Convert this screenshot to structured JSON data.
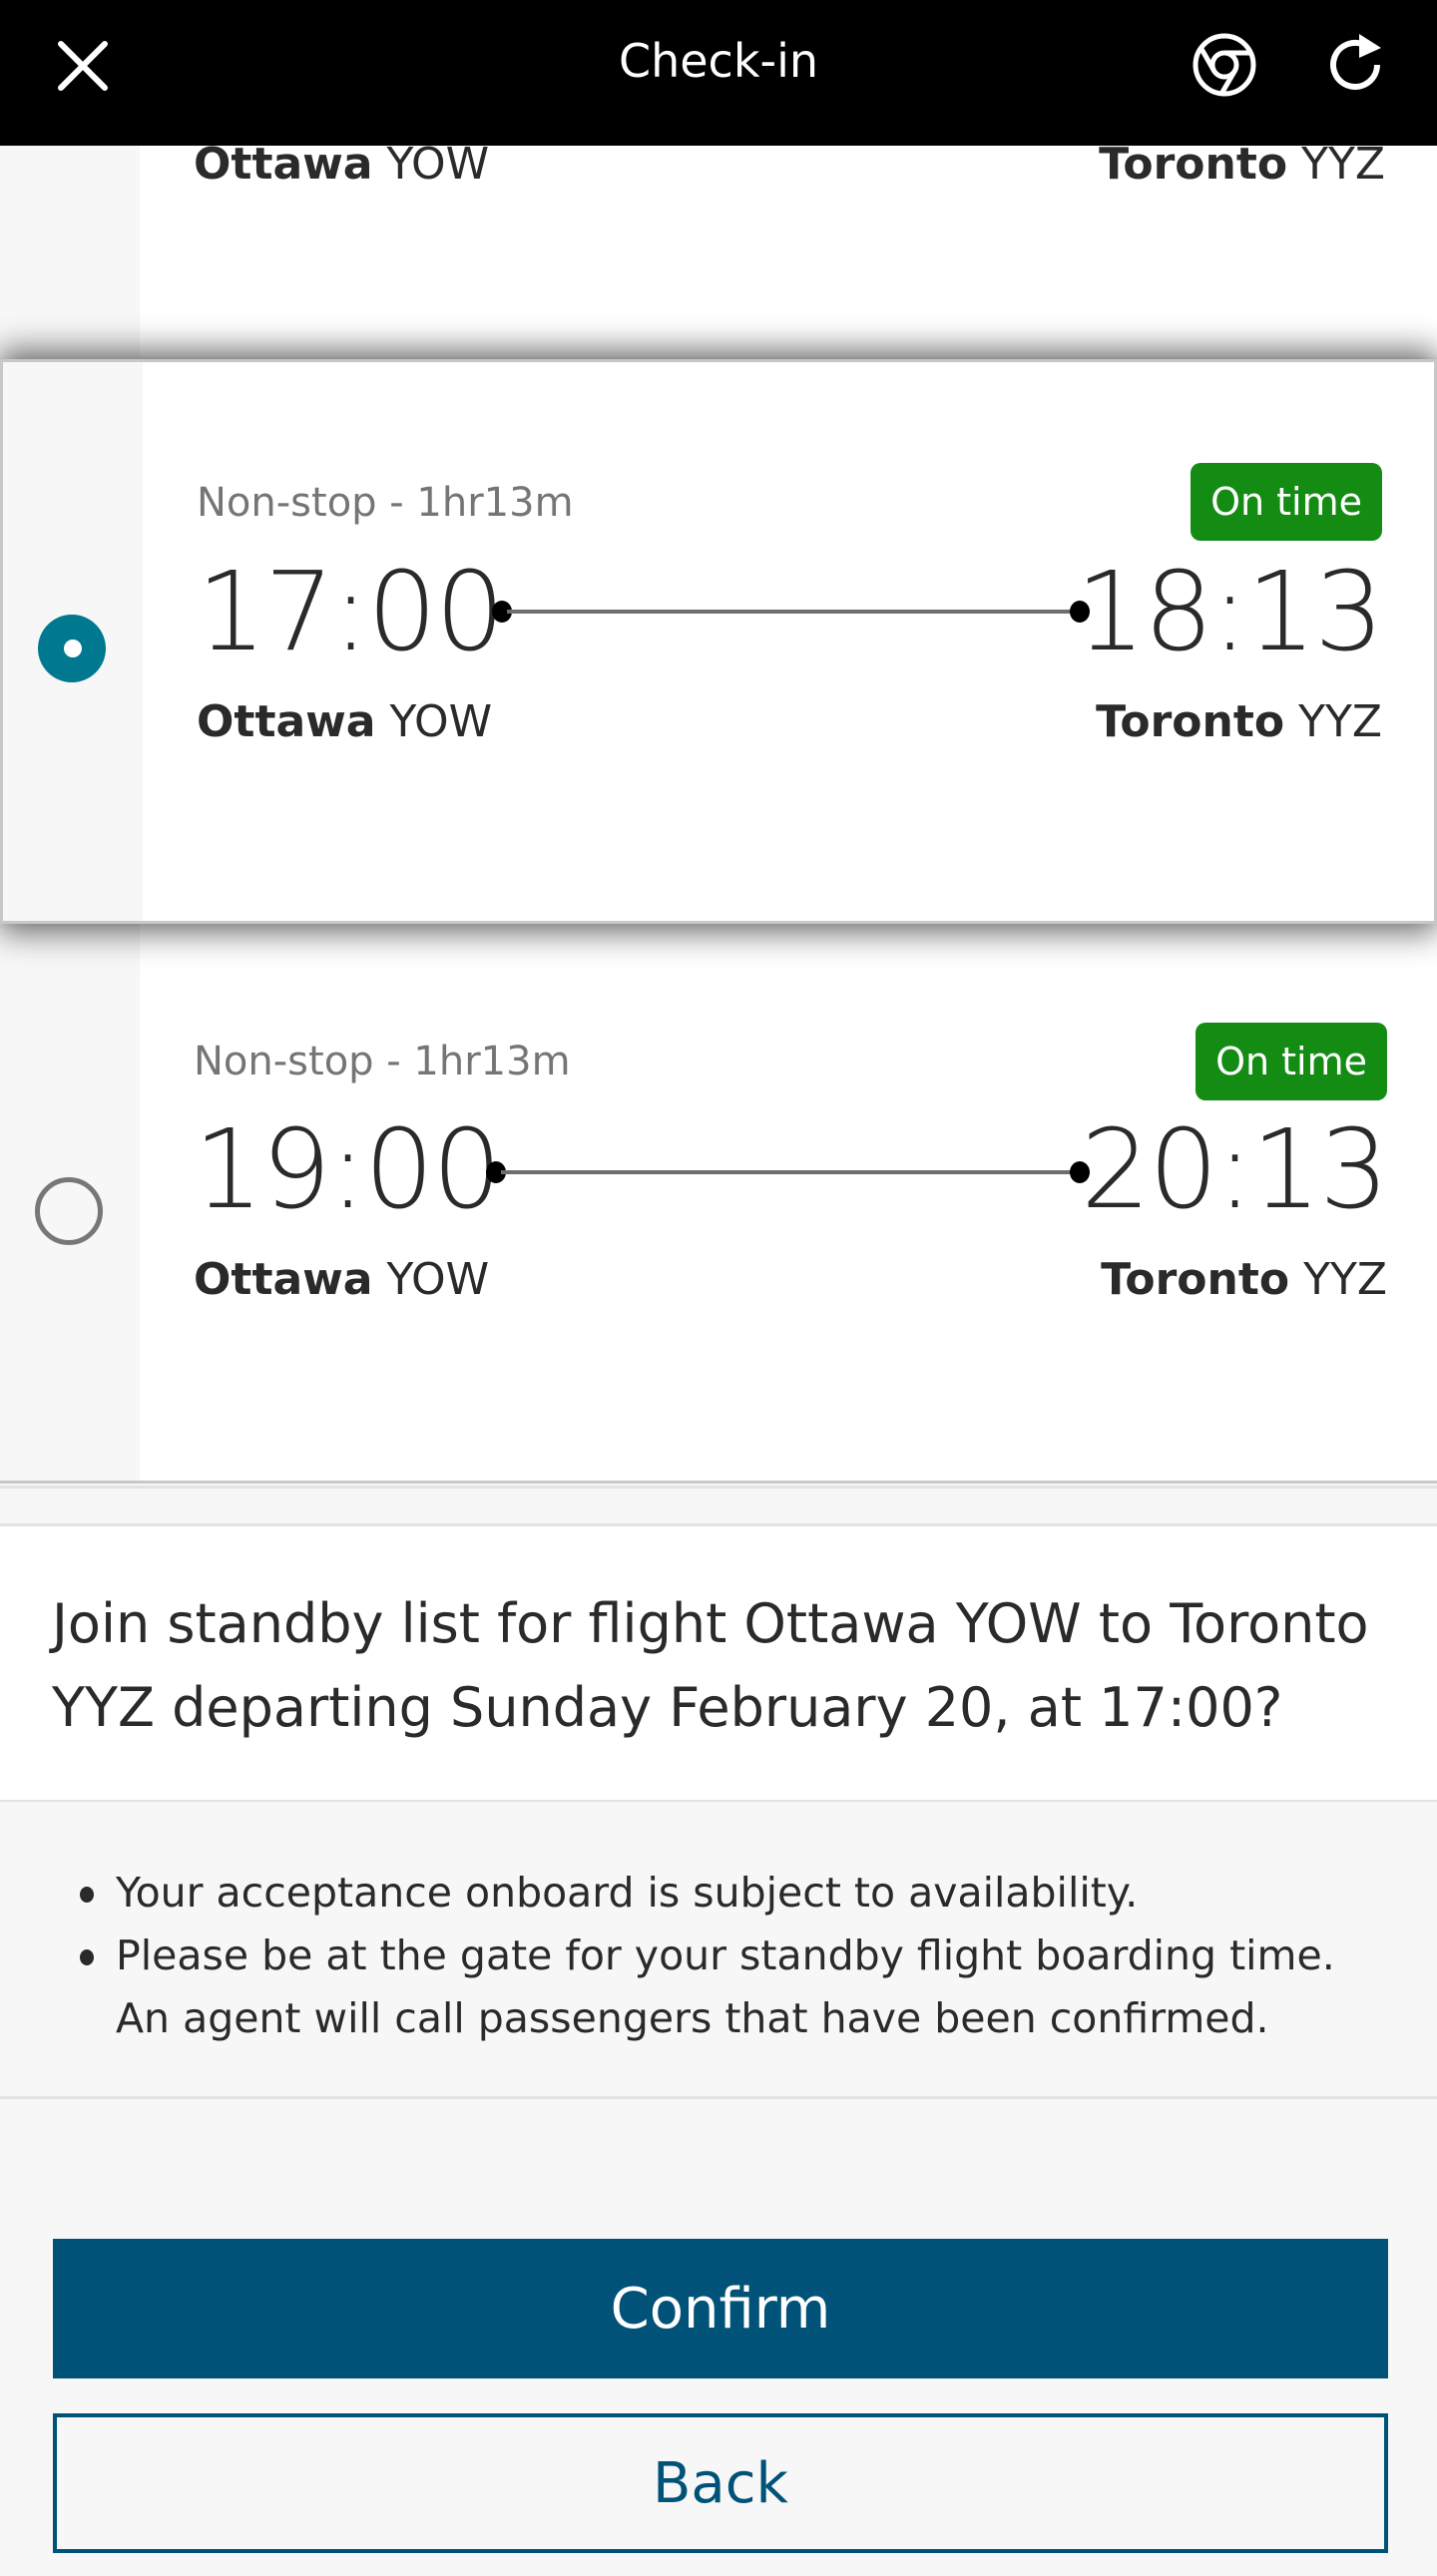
{
  "header": {
    "title": "Check-in",
    "close_icon": "close-icon",
    "browser_icon": "chrome-icon",
    "reload_icon": "reload-icon"
  },
  "flights": [
    {
      "selected": false,
      "partially_visible": true,
      "origin_city": "Ottawa",
      "origin_code": "YOW",
      "destination_city": "Toronto",
      "destination_code": "YYZ"
    },
    {
      "selected": true,
      "duration": "Non-stop - 1hr13m",
      "status": "On time",
      "departure_time": "17:00",
      "arrival_time": "18:13",
      "origin_city": "Ottawa",
      "origin_code": "YOW",
      "destination_city": "Toronto",
      "destination_code": "YYZ"
    },
    {
      "selected": false,
      "duration": "Non-stop - 1hr13m",
      "status": "On time",
      "departure_time": "19:00",
      "arrival_time": "20:13",
      "origin_city": "Ottawa",
      "origin_code": "YOW",
      "destination_city": "Toronto",
      "destination_code": "YYZ"
    }
  ],
  "question": "Join standby list for flight Ottawa YOW to Toronto YYZ departing Sunday February 20, at 17:00?",
  "notes": [
    "Your acceptance onboard is subject to availability.",
    "Please be at the gate for your standby flight boarding time. An agent will call passengers that have been confirmed."
  ],
  "actions": {
    "confirm_label": "Confirm",
    "back_label": "Back"
  },
  "colors": {
    "accent": "#005278",
    "radio_selected": "#00788f",
    "status_on_time": "#148c14",
    "header_bg": "#000000"
  }
}
